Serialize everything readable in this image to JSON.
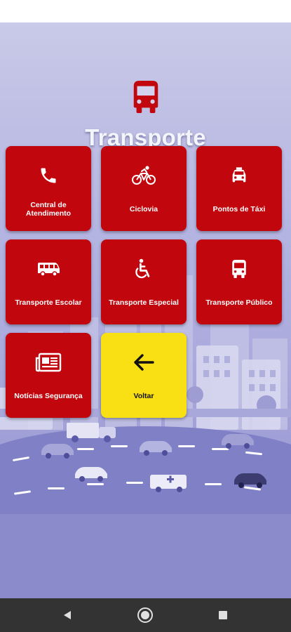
{
  "header": {
    "title": "Transporte",
    "icon": "bus-icon"
  },
  "tiles": [
    {
      "label": "Central de Atendimento",
      "icon": "phone-icon"
    },
    {
      "label": "Ciclovia",
      "icon": "bicycle-icon"
    },
    {
      "label": "Pontos de Táxi",
      "icon": "taxi-icon"
    },
    {
      "label": "Transporte Escolar",
      "icon": "van-icon"
    },
    {
      "label": "Transporte Especial",
      "icon": "wheelchair-icon"
    },
    {
      "label": "Transporte Público",
      "icon": "bus-icon"
    },
    {
      "label": "Notícias Segurança",
      "icon": "newspaper-icon"
    },
    {
      "label": "Voltar",
      "icon": "arrow-left-icon"
    }
  ],
  "navbar": {
    "back": "back-icon",
    "home": "home-icon",
    "recents": "recents-icon"
  },
  "colors": {
    "tile": "#c1060d",
    "back_tile": "#f8e014",
    "background": "#b5b5e2"
  }
}
